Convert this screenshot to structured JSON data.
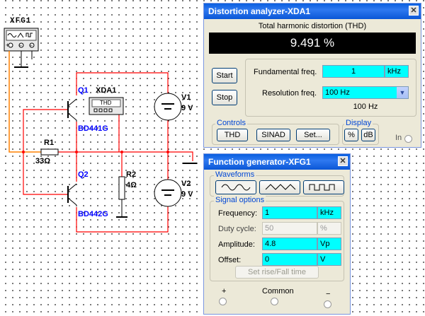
{
  "schematic": {
    "xfg_label": "XFG1",
    "xda_label": "XDA1",
    "xda_thd": "THD",
    "q1": "Q1",
    "q1_part": "BD441G",
    "q2": "Q2",
    "q2_part": "BD442G",
    "r1": "R1",
    "r1_val": "33Ω",
    "r2": "R2",
    "r2_val": "4Ω",
    "v1": "V1",
    "v1_val": "9 V",
    "v2": "V2",
    "v2_val": "9 V",
    "gen_plus": "+",
    "gen_common": "−",
    "gen_minus": "−"
  },
  "distortion": {
    "title": "Distortion analyzer-XDA1",
    "mode_caption": "Total harmonic distortion (THD)",
    "reading": "9.491 %",
    "start_label": "Start",
    "stop_label": "Stop",
    "fund_label": "Fundamental freq.",
    "fund_value": "1",
    "fund_unit": "kHz",
    "res_label": "Resolution freq.",
    "res_value": "100 Hz",
    "res_display": "100 Hz",
    "controls_title": "Controls",
    "thd_btn": "THD",
    "sinad_btn": "SINAD",
    "set_btn": "Set...",
    "display_title": "Display",
    "pct_btn": "%",
    "db_btn": "dB",
    "in_label": "In"
  },
  "funcgen": {
    "title": "Function generator-XFG1",
    "waveforms_title": "Waveforms",
    "signal_title": "Signal options",
    "rows": [
      {
        "label": "Frequency:",
        "value": "1",
        "unit": "kHz"
      },
      {
        "label": "Duty cycle:",
        "value": "50",
        "unit": "%"
      },
      {
        "label": "Amplitude:",
        "value": "4.8",
        "unit": "Vp"
      },
      {
        "label": "Offset:",
        "value": "0",
        "unit": "V"
      }
    ],
    "rise_btn": "Set rise/Fall time",
    "plus_label": "+",
    "common_label": "Common",
    "minus_label": "−"
  },
  "colors": {
    "wire_red": "#ff0000",
    "wire_orange": "#ff8000",
    "title_blue": "#0a5fdf",
    "field_cyan": "#00ffff",
    "part_blue": "#0000ff"
  }
}
